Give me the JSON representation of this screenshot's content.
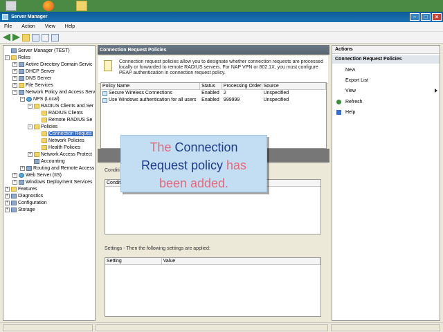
{
  "window": {
    "title": "Server Manager"
  },
  "menu": [
    "File",
    "Action",
    "View",
    "Help"
  ],
  "tree": [
    {
      "label": "Server Manager (TEST)",
      "indent": 0,
      "icon": "server-icon",
      "exp": ""
    },
    {
      "label": "Roles",
      "indent": 0,
      "icon": "folder-icon",
      "exp": "−"
    },
    {
      "label": "Active Directory Domain Servic",
      "indent": 1,
      "icon": "server-icon",
      "exp": "+"
    },
    {
      "label": "DHCP Server",
      "indent": 1,
      "icon": "server-icon",
      "exp": "+"
    },
    {
      "label": "DNS Server",
      "indent": 1,
      "icon": "server-icon",
      "exp": "+"
    },
    {
      "label": "File Services",
      "indent": 1,
      "icon": "folder-icon",
      "exp": "+"
    },
    {
      "label": "Network Policy and Access Serv",
      "indent": 1,
      "icon": "server-icon",
      "exp": "−"
    },
    {
      "label": "NPS (Local)",
      "indent": 2,
      "icon": "globe-icon",
      "exp": "−"
    },
    {
      "label": "RADIUS Clients and Ser",
      "indent": 3,
      "icon": "folder-icon",
      "exp": "−"
    },
    {
      "label": "RADIUS Clients",
      "indent": 4,
      "icon": "folder-icon",
      "exp": ""
    },
    {
      "label": "Remote RADIUS Se",
      "indent": 4,
      "icon": "folder-icon",
      "exp": ""
    },
    {
      "label": "Policies",
      "indent": 3,
      "icon": "folder-icon",
      "exp": "−"
    },
    {
      "label": "Connection Reques",
      "indent": 4,
      "icon": "folder-icon",
      "exp": "",
      "selected": true
    },
    {
      "label": "Network Policies",
      "indent": 4,
      "icon": "folder-icon",
      "exp": ""
    },
    {
      "label": "Health Policies",
      "indent": 4,
      "icon": "folder-icon",
      "exp": ""
    },
    {
      "label": "Network Access Protect",
      "indent": 3,
      "icon": "folder-icon",
      "exp": "+"
    },
    {
      "label": "Accounting",
      "indent": 3,
      "icon": "server-icon",
      "exp": ""
    },
    {
      "label": "Routing and Remote Access",
      "indent": 2,
      "icon": "server-icon",
      "exp": "+"
    },
    {
      "label": "Web Server (IIS)",
      "indent": 1,
      "icon": "globe-icon",
      "exp": "+"
    },
    {
      "label": "Windows Deployment Services",
      "indent": 1,
      "icon": "server-icon",
      "exp": "+"
    },
    {
      "label": "Features",
      "indent": 0,
      "icon": "folder-icon",
      "exp": "+"
    },
    {
      "label": "Diagnostics",
      "indent": 0,
      "icon": "server-icon",
      "exp": "+"
    },
    {
      "label": "Configuration",
      "indent": 0,
      "icon": "server-icon",
      "exp": "+"
    },
    {
      "label": "Storage",
      "indent": 0,
      "icon": "server-icon",
      "exp": "+"
    }
  ],
  "center": {
    "header": "Connection Request Policies",
    "description": "Connection request policies allow you to designate whether connection requests are processed locally or forwarded to remote RADIUS servers. For NAP VPN or 802.1X, you must configure PEAP authentication in connection request policy.",
    "columns": [
      "Policy Name",
      "Status",
      "Processing Order",
      "Source"
    ],
    "rows": [
      [
        "Secure Wireless Connections",
        "Enabled",
        "2",
        "Unspecified"
      ],
      [
        "Use Windows authentication for all users",
        "Enabled",
        "999999",
        "Unspecified"
      ]
    ],
    "conditions_label": "Conditi",
    "conditions_col": "Conditi",
    "settings_label": "Settings - Then the following settings are applied:",
    "settings_columns": [
      "Setting",
      "Value"
    ]
  },
  "actions": {
    "header": "Actions",
    "subheader": "Connection Request Policies",
    "items": [
      "New",
      "Export List",
      "View",
      "Refresh",
      "Help"
    ]
  },
  "callout": {
    "w1": "The",
    "w2": "Connection",
    "w3": "Request policy",
    "w4": "has",
    "w5": "been added."
  }
}
